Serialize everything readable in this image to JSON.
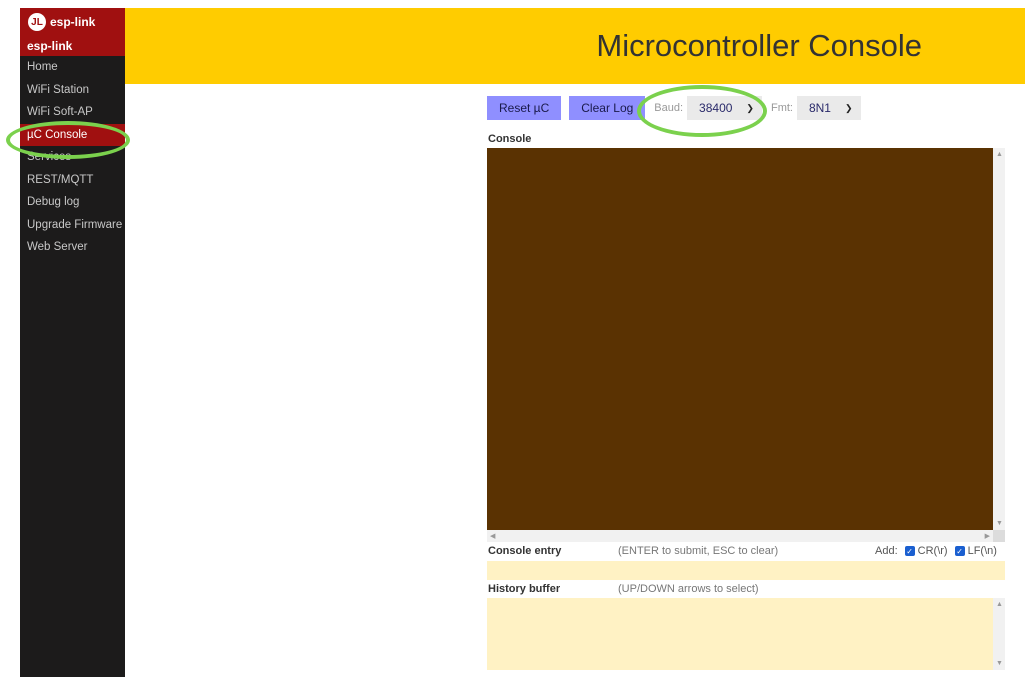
{
  "sidebar": {
    "brand": "esp-link",
    "brand_sub": "esp-link",
    "items": [
      {
        "label": "Home"
      },
      {
        "label": "WiFi Station"
      },
      {
        "label": "WiFi Soft-AP"
      },
      {
        "label": "µC Console",
        "active": true
      },
      {
        "label": "Services"
      },
      {
        "label": "REST/MQTT"
      },
      {
        "label": "Debug log"
      },
      {
        "label": "Upgrade Firmware"
      },
      {
        "label": "Web Server"
      }
    ]
  },
  "header": {
    "title": "Microcontroller Console"
  },
  "toolbar": {
    "reset_label": "Reset µC",
    "clear_label": "Clear Log",
    "baud_label": "Baud:",
    "baud_value": "38400",
    "fmt_label": "Fmt:",
    "fmt_value": "8N1"
  },
  "console": {
    "label": "Console",
    "background": "#5a3202"
  },
  "entry": {
    "label": "Console entry",
    "hint": "(ENTER to submit, ESC to clear)",
    "add_label": "Add:",
    "cr_label": "CR(\\r)",
    "lf_label": "LF(\\n)"
  },
  "history": {
    "label": "History buffer",
    "hint": "(UP/DOWN arrows to select)"
  },
  "colors": {
    "header": "#ffcc00",
    "sidebar": "#1c1b1b",
    "accent": "#a01010",
    "button": "#8f8fff",
    "input_bg": "#fff2c4",
    "highlight": "#7bd14d"
  }
}
